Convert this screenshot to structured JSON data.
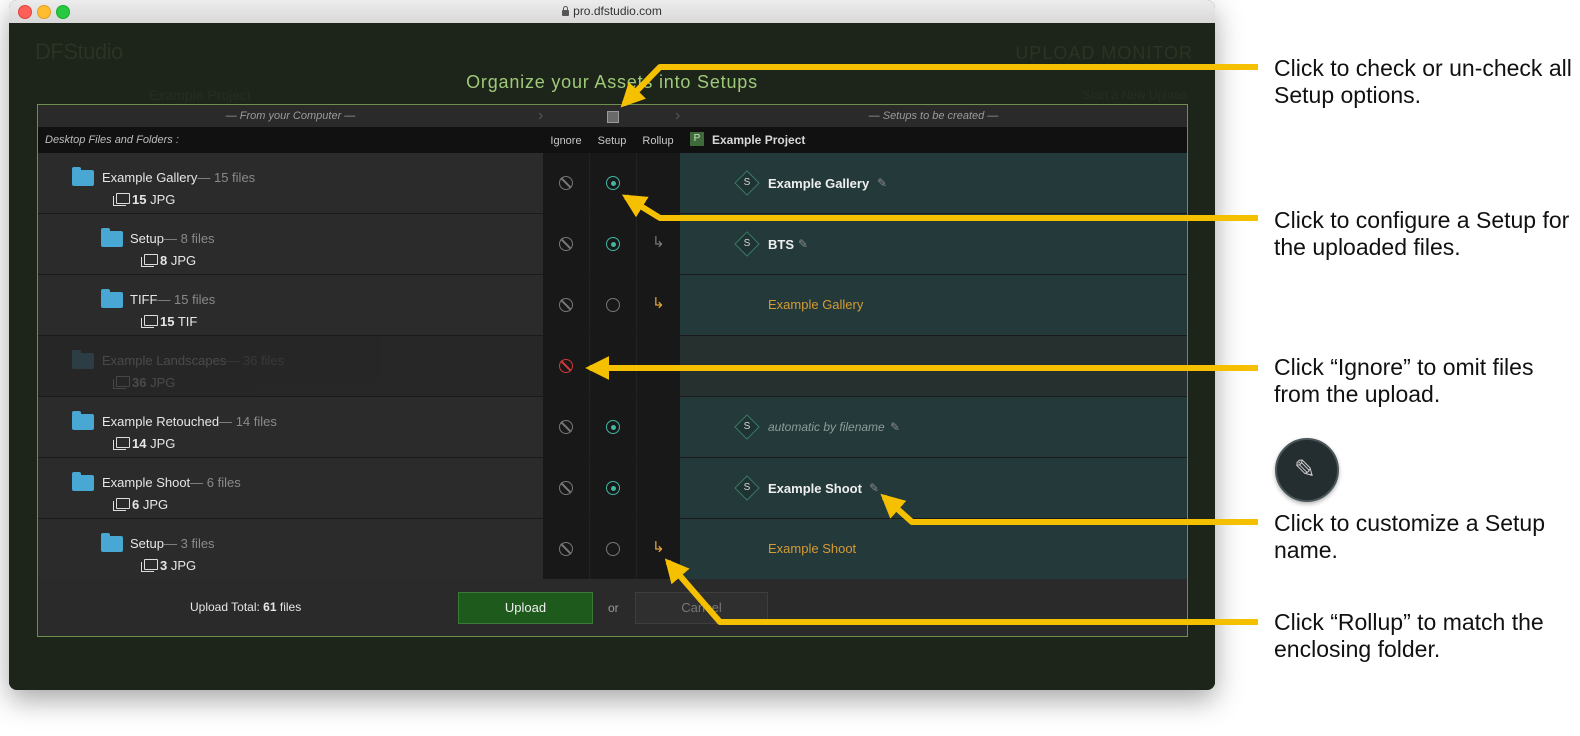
{
  "browser": {
    "url": "pro.dfstudio.com"
  },
  "app": {
    "logo": "DFStudio",
    "upload_monitor": "UPLOAD MONITOR",
    "breadcrumb": "Example Project",
    "crumb_right": "Start a New Upload"
  },
  "dialog": {
    "title": "Organize your Assets into Setups",
    "from_header": "— From your Computer —",
    "to_header": "— Setups to be created —",
    "desktop_label": "Desktop Files and Folders :",
    "col_ignore": "Ignore",
    "col_setup": "Setup",
    "col_rollup": "Rollup",
    "project_badge": "P",
    "project_name": "Example Project",
    "rows": [
      {
        "name": "Example Gallery",
        "count": "— 15 files",
        "num": "15",
        "type": "JPG",
        "setup_name": "Example Gallery"
      },
      {
        "name": "Setup",
        "count": "— 8 files",
        "num": "8",
        "type": "JPG",
        "setup_name": "BTS"
      },
      {
        "name": "TIFF",
        "count": "— 15 files",
        "num": "15",
        "type": "TIF",
        "setup_name": "Example Gallery"
      },
      {
        "name": "Example Landscapes",
        "count": "— 36 files",
        "num": "36",
        "type": "JPG",
        "setup_name": ""
      },
      {
        "name": "Example Retouched",
        "count": "— 14 files",
        "num": "14",
        "type": "JPG",
        "setup_name": "automatic by filename"
      },
      {
        "name": "Example Shoot",
        "count": "— 6 files",
        "num": "6",
        "type": "JPG",
        "setup_name": "Example Shoot"
      },
      {
        "name": "Setup",
        "count": "— 3 files",
        "num": "3",
        "type": "JPG",
        "setup_name": "Example Shoot"
      }
    ],
    "setup_badge": "S",
    "footer": {
      "total_label": "Upload Total:",
      "total_num": "61",
      "total_unit": "files",
      "upload": "Upload",
      "or": "or",
      "cancel": "Cancel"
    }
  },
  "annotations": {
    "check_all": "Click to check or un-check all Setup options.",
    "configure": "Click to configure a Setup for the uploaded files.",
    "ignore": "Click “Ignore” to omit files from the upload.",
    "customize": "Click to customize a Setup name.",
    "rollup": "Click “Rollup” to match the enclosing folder."
  },
  "colors": {
    "accent_green": "#9fc97a",
    "arrow": "#f5c000",
    "setup_on": "#3fb7a3",
    "rollup_on": "#e0a43a",
    "ignore_on": "#d03a3a"
  }
}
